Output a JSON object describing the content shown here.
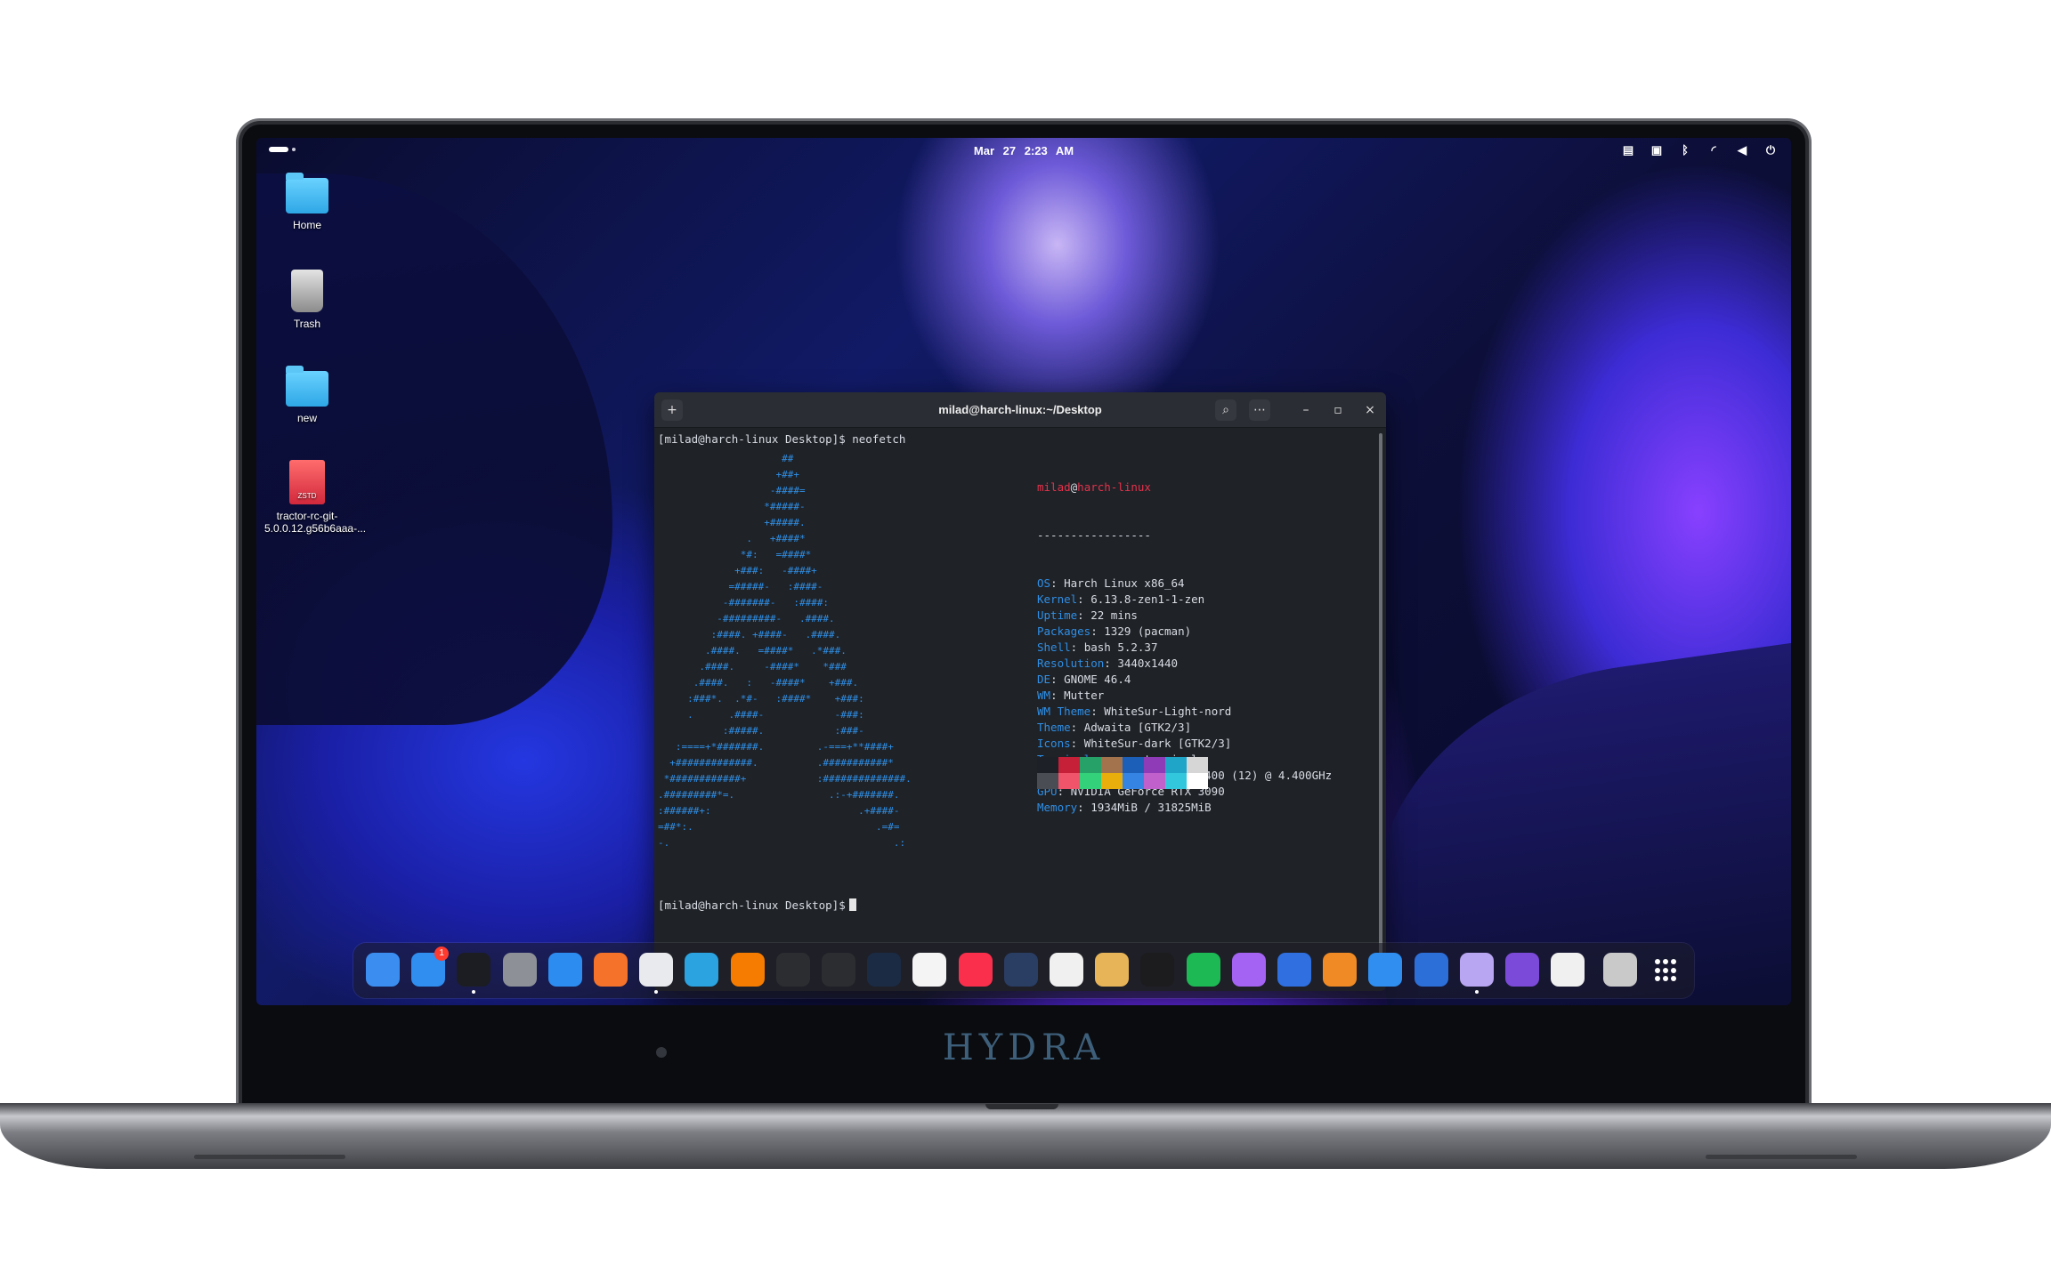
{
  "topbar": {
    "date": "Mar 27",
    "time": "2:23 AM",
    "tray_icons": [
      "display-icon",
      "screenshot-icon",
      "bluetooth-icon",
      "wifi-icon",
      "volume-icon",
      "power-icon"
    ]
  },
  "desktop": {
    "icons": [
      {
        "label": "Home",
        "icon": "home-folder-icon"
      },
      {
        "label": "Trash",
        "icon": "trash-icon"
      },
      {
        "label": "new",
        "icon": "folder-icon"
      },
      {
        "label": "tractor-rc-git-5.0.0.12.g56b6aaa-...",
        "icon": "archive-file-icon",
        "thumb": "ZSTD"
      }
    ]
  },
  "terminal": {
    "title": "milad@harch-linux:~/Desktop",
    "prompt1": "[milad@harch-linux Desktop]$ neofetch",
    "prompt2": "[milad@harch-linux Desktop]$",
    "ascii": "                     ##\n                    +##+\n                   -####=\n                  *#####-\n                  +#####.\n               .   +####*\n              *#:   =####*\n             +###:   -####+\n            =#####-   :####-\n           -#######-   :####:\n          -#########-   .####.\n         :####. +####-   .####.\n        .####.   =####*   .*###.\n       .####.     -####*    *###\n      .####.   :   -####*    +###.\n     :###*.  .*#-   :####*    +###:\n     .      .####-            -###:\n           :#####.            :###-\n   :====+*#######.         .-===+**####+\n  +#############.          .###########*\n *############+            :##############.\n.#########*=.                .:-+#######.\n:######+:                         .+####-\n=##*:.                               .=#=\n-.                                      .:",
    "user": "milad",
    "at": "@",
    "host": "harch-linux",
    "separator": "-----------------",
    "info": [
      {
        "key": "OS",
        "value": "Harch Linux x86_64"
      },
      {
        "key": "Kernel",
        "value": "6.13.8-zen1-1-zen"
      },
      {
        "key": "Uptime",
        "value": "22 mins"
      },
      {
        "key": "Packages",
        "value": "1329 (pacman)"
      },
      {
        "key": "Shell",
        "value": "bash 5.2.37"
      },
      {
        "key": "Resolution",
        "value": "3440x1440"
      },
      {
        "key": "DE",
        "value": "GNOME 46.4"
      },
      {
        "key": "WM",
        "value": "Mutter"
      },
      {
        "key": "WM Theme",
        "value": "WhiteSur-Light-nord"
      },
      {
        "key": "Theme",
        "value": "Adwaita [GTK2/3]"
      },
      {
        "key": "Icons",
        "value": "WhiteSur-dark [GTK2/3]"
      },
      {
        "key": "Terminal",
        "value": "gnome-terminal"
      },
      {
        "key": "CPU",
        "value": "12th Gen Intel i5-12400 (12) @ 4.400GHz"
      },
      {
        "key": "GPU",
        "value": "NVIDIA GeForce RTX 3090"
      },
      {
        "key": "Memory",
        "value": "1934MiB / 31825MiB"
      }
    ],
    "palette_top": [
      "#1d2026",
      "#c61f38",
      "#26a269",
      "#a2734c",
      "#1c5fb8",
      "#8f3bb8",
      "#1fa5c8",
      "#d6d6d6"
    ],
    "palette_bottom": [
      "#4a4d54",
      "#f0546a",
      "#33d17a",
      "#e9ad0c",
      "#3584e4",
      "#c061cb",
      "#33c7de",
      "#ffffff"
    ]
  },
  "dock": {
    "apps": [
      {
        "name": "safari-icon",
        "color": "#3b8ef0",
        "running": false
      },
      {
        "name": "finder-icon",
        "color": "#2f8ef0",
        "running": false,
        "badge": "1"
      },
      {
        "name": "terminal-icon",
        "color": "#1c1d22",
        "running": true
      },
      {
        "name": "settings-icon",
        "color": "#8d9096",
        "running": false
      },
      {
        "name": "app-store-icon",
        "color": "#2d8cf0",
        "running": false
      },
      {
        "name": "firefox-icon",
        "color": "#f5722b",
        "running": false
      },
      {
        "name": "chrome-icon",
        "color": "#e8eaed",
        "running": true
      },
      {
        "name": "telegram-icon",
        "color": "#2aa3e0",
        "running": false
      },
      {
        "name": "vlc-icon",
        "color": "#f57c00",
        "running": false
      },
      {
        "name": "activity-monitor-icon",
        "color": "#2b2d30",
        "running": false
      },
      {
        "name": "blender-icon",
        "color": "#2b2d30",
        "running": false
      },
      {
        "name": "vscode-icon",
        "color": "#1b2b44",
        "running": false
      },
      {
        "name": "photos-icon",
        "color": "#f4f4f4",
        "running": false
      },
      {
        "name": "music-icon",
        "color": "#fa2f4c",
        "running": false
      },
      {
        "name": "screenshot-tool-icon",
        "color": "#2a3d63",
        "running": false
      },
      {
        "name": "text-editor-icon",
        "color": "#f0f0f0",
        "running": false
      },
      {
        "name": "calculator-icon",
        "color": "#e7b457",
        "running": false
      },
      {
        "name": "clock-icon",
        "color": "#1c1c1e",
        "running": false
      },
      {
        "name": "spotify-icon",
        "color": "#1db954",
        "running": false
      },
      {
        "name": "github-icon",
        "color": "#a463f2",
        "running": false
      },
      {
        "name": "vpn-shield-icon",
        "color": "#2f6fe0",
        "running": false
      },
      {
        "name": "edge-icon",
        "color": "#f08a24",
        "running": false
      },
      {
        "name": "system-monitor-icon",
        "color": "#2f8ef0",
        "running": false
      },
      {
        "name": "sync-icon",
        "color": "#2d6fd8",
        "running": false
      },
      {
        "name": "disk-utility-icon",
        "color": "#b9a6f2",
        "running": true
      },
      {
        "name": "extensions-icon",
        "color": "#7b4ad8",
        "running": false
      },
      {
        "name": "software-center-icon",
        "color": "#f0f0f0",
        "running": false
      },
      {
        "name": "trash-dock-icon",
        "color": "#c9c9c9",
        "running": false
      }
    ],
    "show_apps": "show-apps-icon"
  },
  "laptop": {
    "brand": "HYDRA"
  }
}
